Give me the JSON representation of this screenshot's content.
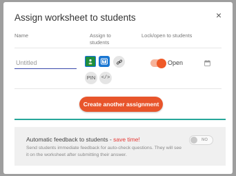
{
  "modal": {
    "title": "Assign worksheet to students",
    "close_glyph": "×"
  },
  "columns": {
    "name": "Name",
    "assign": "Assign to students",
    "lock": "Lock/open to students"
  },
  "assignment": {
    "name_placeholder": "Untitled",
    "pin_label": "PIN",
    "embed_label": "</>",
    "status_label": "Open",
    "status_on": true
  },
  "create_button": "Create another assignment",
  "feedback": {
    "title": "Automatic feedback to students - ",
    "highlight": "save time!",
    "description": "Send students immediate feedback for auto-check questions. They will see it on the worksheet after submitting their answer.",
    "toggle_label": "NO",
    "toggle_on": false
  },
  "colors": {
    "accent": "#e8552b",
    "teal": "#26a69a",
    "input_underline": "#3949ab"
  },
  "icons": [
    "close-icon",
    "google-classroom-icon",
    "microsoft-teams-icon",
    "link-icon",
    "calendar-icon"
  ]
}
